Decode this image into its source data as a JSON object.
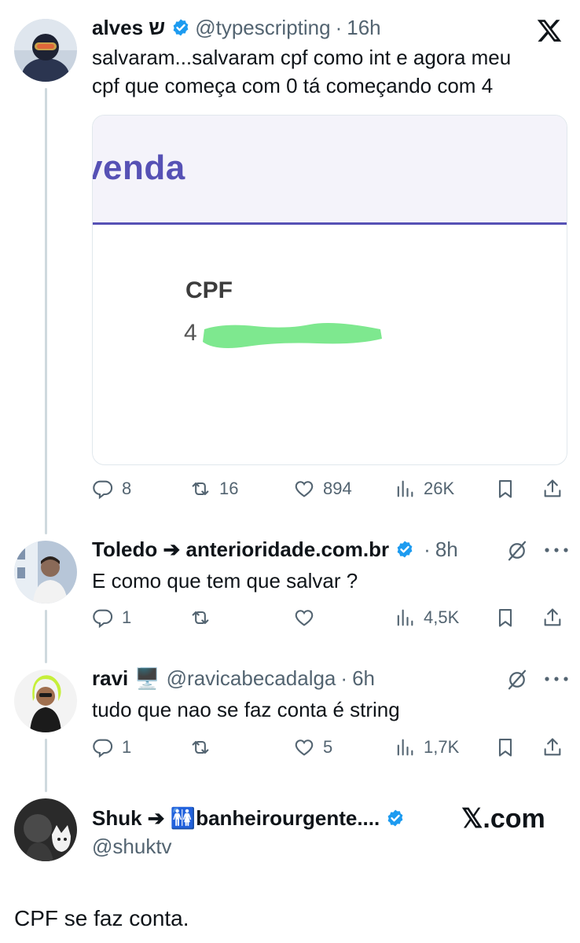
{
  "thread": {
    "main": {
      "name": "alves ש",
      "handle": "@typescripting",
      "time": "16h",
      "text_line1": "salvaram...salvaram cpf como int e agora meu",
      "text_line2": "cpf que começa com 0 tá começando com 4",
      "media": {
        "title": "venda",
        "field_label": "CPF",
        "field_value_visible": "4"
      },
      "stats": {
        "replies": "8",
        "reposts": "16",
        "likes": "894",
        "views": "26K"
      }
    },
    "replies": [
      {
        "name": "Toledo ➔ anterioridade.com.br",
        "handle": "",
        "time": "8h",
        "text": "E como que tem que salvar ?",
        "stats": {
          "replies": "1",
          "reposts": "",
          "likes": "",
          "views": "4,5K"
        }
      },
      {
        "name": "ravi",
        "emoji": "🖥️",
        "handle": "@ravicabecadalga",
        "time": "6h",
        "text": "tudo que nao se faz conta é string",
        "stats": {
          "replies": "1",
          "reposts": "",
          "likes": "5",
          "views": "1,7K"
        }
      }
    ],
    "quote": {
      "name_prefix": "Shuk ➔ ",
      "name_emoji": "🚻",
      "name_suffix": "banheirourgente....",
      "handle": "@shuktv",
      "text": "CPF se faz conta."
    }
  },
  "branding": {
    "xcom": "𝕏.com"
  },
  "colors": {
    "accent": "#1d9bf0",
    "media_accent": "#5651b5",
    "redaction": "#7ee88f"
  }
}
